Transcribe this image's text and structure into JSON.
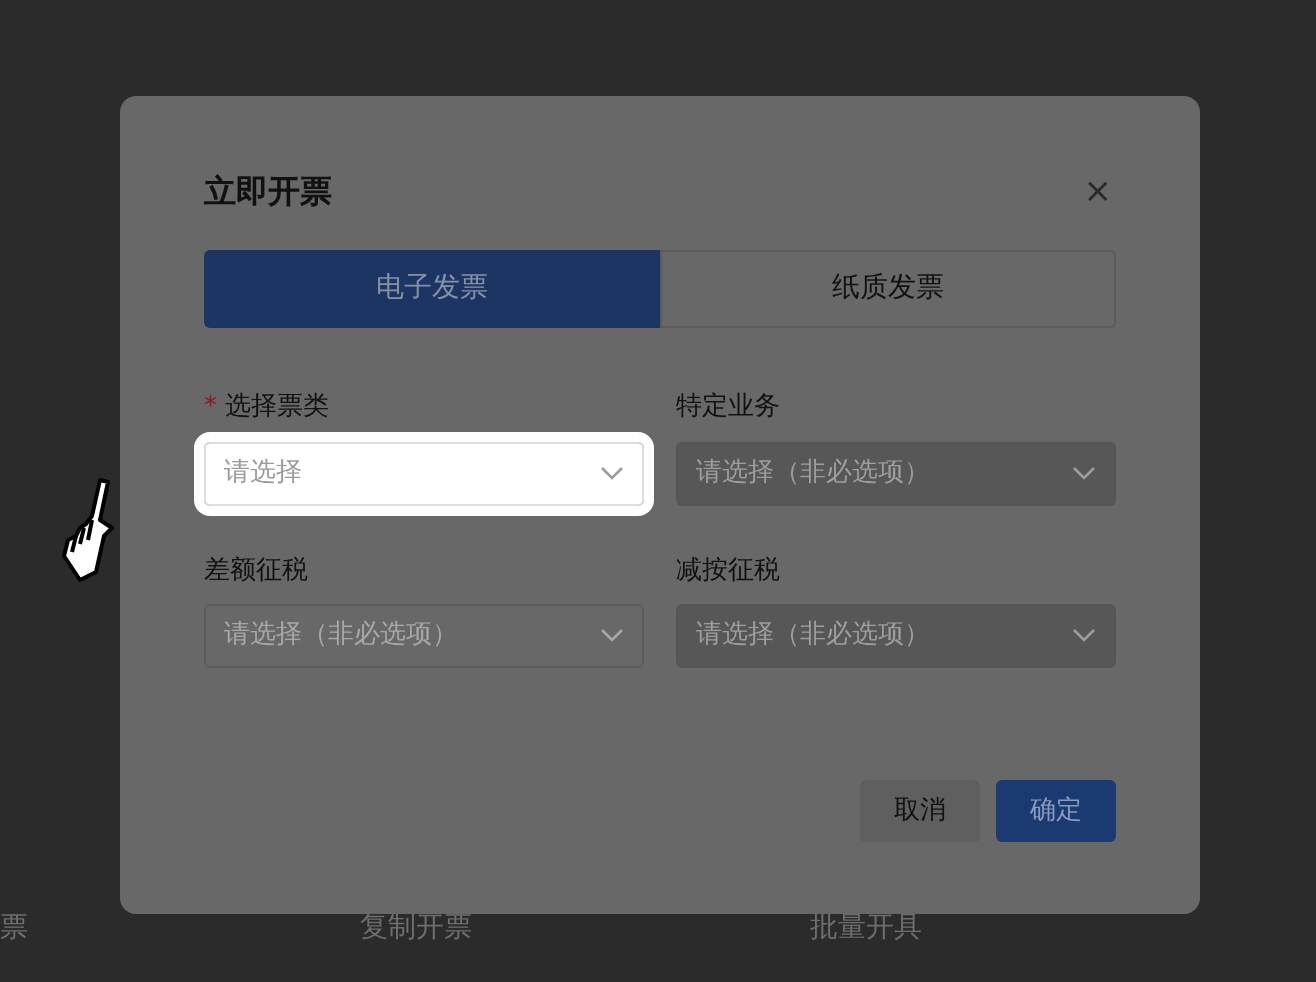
{
  "background": {
    "texts": [
      "票",
      "复制开票",
      "批量开具"
    ]
  },
  "dialog": {
    "title": "立即开票",
    "close": "×",
    "tabs": [
      {
        "label": "电子发票",
        "selected": true
      },
      {
        "label": "纸质发票",
        "selected": false
      }
    ],
    "fields": [
      {
        "label": "选择票类",
        "required_mark": "*",
        "placeholder": "请选择",
        "disabled": false,
        "highlighted": true
      },
      {
        "label": "特定业务",
        "placeholder": "请选择（非必选项）",
        "disabled": true,
        "highlighted": false
      },
      {
        "label": "差额征税",
        "placeholder": "请选择（非必选项）",
        "disabled": false,
        "highlighted": false
      },
      {
        "label": "减按征税",
        "placeholder": "请选择（非必选项）",
        "disabled": true,
        "highlighted": false
      }
    ],
    "buttons": [
      {
        "label": "取消",
        "kind": "secondary"
      },
      {
        "label": "确定",
        "kind": "primary"
      }
    ]
  }
}
